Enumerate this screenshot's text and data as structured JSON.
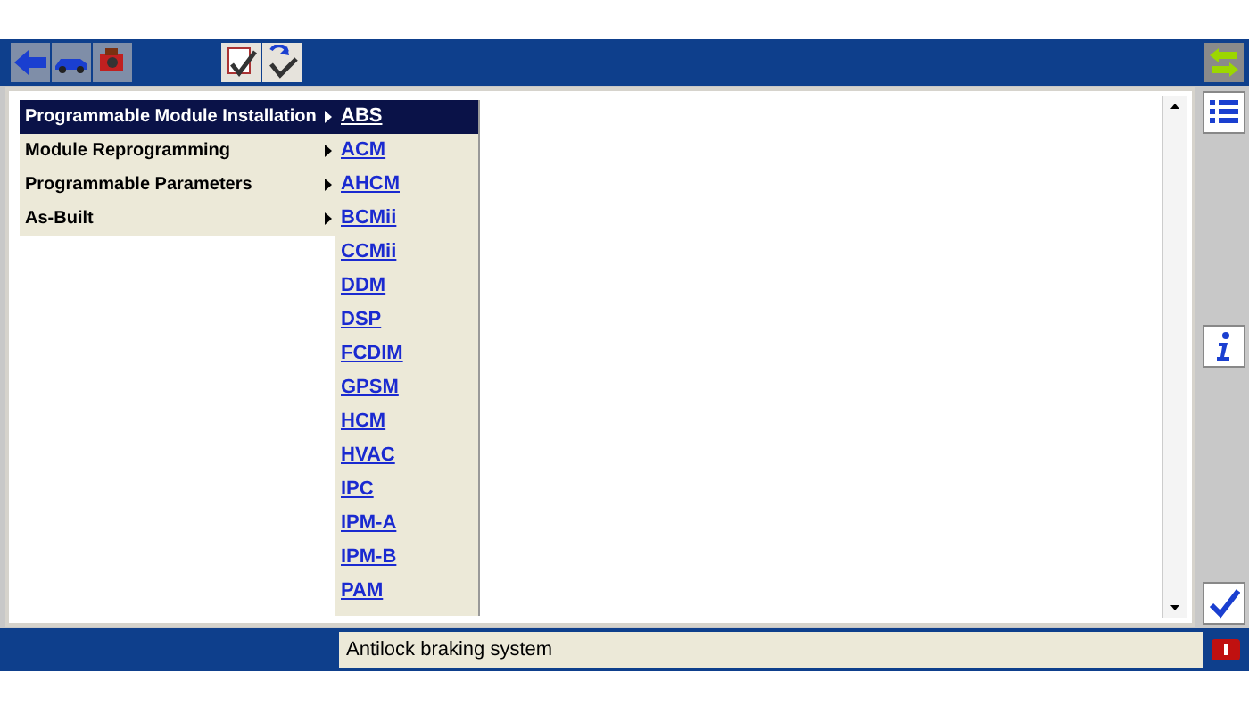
{
  "menu": [
    {
      "label": "Programmable Module Installation",
      "selected": true,
      "has_submenu": true
    },
    {
      "label": "Module Reprogramming",
      "selected": false,
      "has_submenu": true
    },
    {
      "label": "Programmable Parameters",
      "selected": false,
      "has_submenu": true
    },
    {
      "label": "As-Built",
      "selected": false,
      "has_submenu": true
    }
  ],
  "submenu": [
    {
      "label": "ABS",
      "selected": true
    },
    {
      "label": "ACM",
      "selected": false
    },
    {
      "label": "AHCM",
      "selected": false
    },
    {
      "label": "BCMii",
      "selected": false
    },
    {
      "label": "CCMii",
      "selected": false
    },
    {
      "label": "DDM",
      "selected": false
    },
    {
      "label": "DSP",
      "selected": false
    },
    {
      "label": "FCDIM",
      "selected": false
    },
    {
      "label": "GPSM",
      "selected": false
    },
    {
      "label": "HCM",
      "selected": false
    },
    {
      "label": "HVAC",
      "selected": false
    },
    {
      "label": "IPC",
      "selected": false
    },
    {
      "label": "IPM-A",
      "selected": false
    },
    {
      "label": "IPM-B",
      "selected": false
    },
    {
      "label": "PAM",
      "selected": false
    }
  ],
  "status_bar": {
    "text": "Antilock braking system"
  }
}
